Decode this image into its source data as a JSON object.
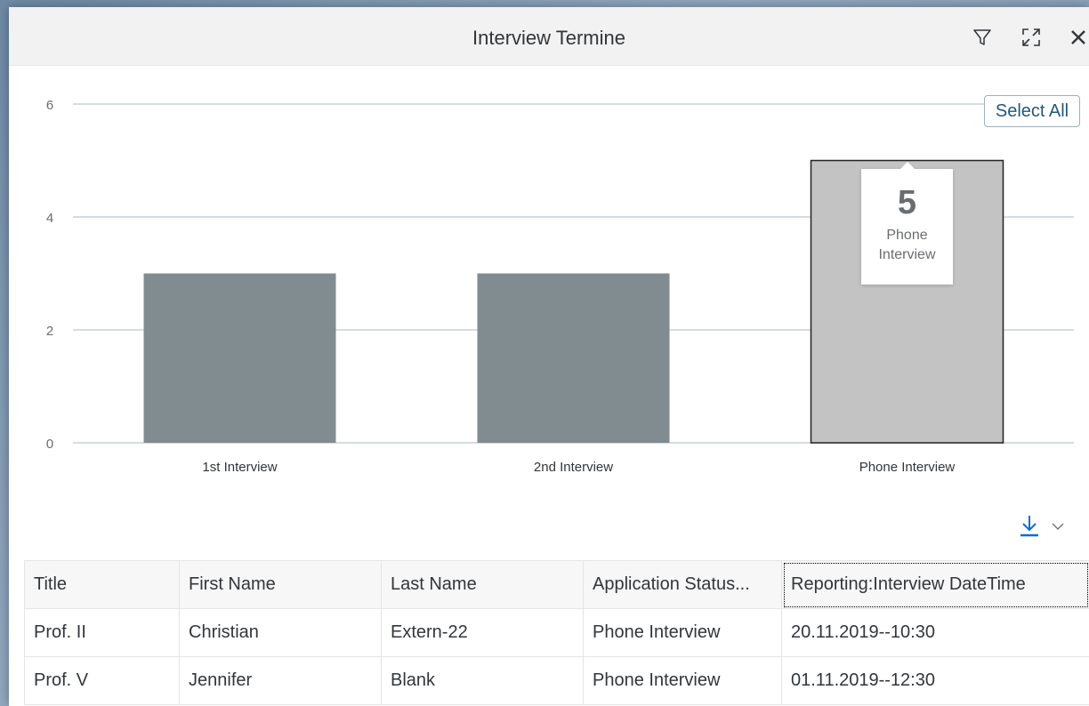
{
  "dialog": {
    "title": "Interview Termine",
    "select_all_label": "Select All"
  },
  "icons": {
    "filter": "filter-icon",
    "fullscreen": "fullscreen-icon",
    "close": "close-icon",
    "download": "download-icon",
    "dropdown": "chevron-down-icon"
  },
  "chart_data": {
    "type": "bar",
    "categories": [
      "1st Interview",
      "2nd Interview",
      "Phone Interview"
    ],
    "values": [
      3,
      3,
      5
    ],
    "yticks": [
      0,
      2,
      4,
      6
    ],
    "ylim": [
      0,
      6
    ],
    "selected_index": 2,
    "grid": true,
    "colors": {
      "bar": "#818c90",
      "selected": "#c3c3c3",
      "gridline": "#c7d0d8"
    }
  },
  "tooltip": {
    "value": "5",
    "label": "Phone Interview"
  },
  "table": {
    "columns": [
      "Title",
      "First Name",
      "Last Name",
      "Application Status...",
      "Reporting:Interview DateTime"
    ],
    "rows": [
      [
        "Prof. II",
        "Christian",
        "Extern-22",
        "Phone Interview",
        "20.11.2019--10:30"
      ],
      [
        "Prof. V",
        "Jennifer",
        "Blank",
        "Phone Interview",
        "01.11.2019--12:30"
      ]
    ]
  }
}
